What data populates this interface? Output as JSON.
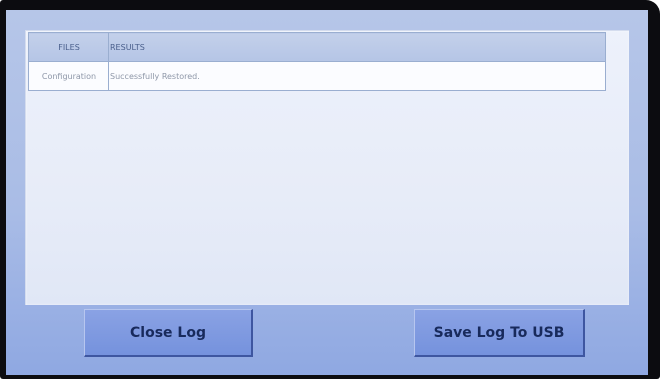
{
  "log": {
    "columns": [
      "FILES",
      "RESULTS"
    ],
    "rows": [
      {
        "file": "Configuration",
        "result": "Successfully Restored."
      }
    ]
  },
  "actions": {
    "close_label": "Close Log",
    "save_label": "Save Log To USB"
  },
  "colors": {
    "panel_background": "#e8edf8",
    "screen_background": "#a9bce6",
    "button": "#7f9ae0",
    "button_text": "#182a5c"
  }
}
